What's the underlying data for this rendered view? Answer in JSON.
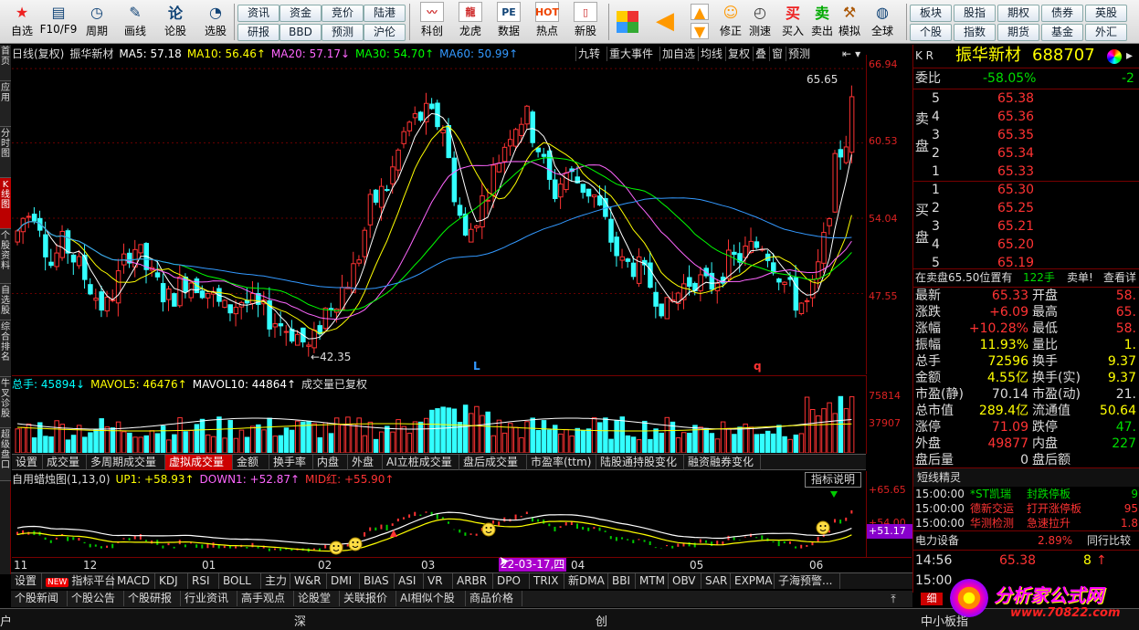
{
  "toolbar": {
    "buttons": [
      {
        "label": "自选",
        "icon": "★"
      },
      {
        "label": "F10/F9",
        "icon": "▤"
      },
      {
        "label": "周期",
        "icon": "◷"
      },
      {
        "label": "画线",
        "icon": "✎"
      },
      {
        "label": "论股",
        "icon": "论"
      },
      {
        "label": "选股",
        "icon": "◔"
      }
    ],
    "small_buttons": [
      "资讯",
      "资金",
      "竞价",
      "陆港",
      "研报",
      "BBD",
      "预测",
      "沪伦"
    ],
    "buttons2": [
      {
        "label": "科创",
        "icon": "〰"
      },
      {
        "label": "龙虎",
        "icon": "龍"
      },
      {
        "label": "数据",
        "icon": "PE"
      },
      {
        "label": "热点",
        "icon": "HOT"
      },
      {
        "label": "新股",
        "icon": "▯"
      }
    ],
    "buttons3": [
      {
        "label": "修正",
        "icon": "☺"
      },
      {
        "label": "测速",
        "icon": "◴"
      },
      {
        "label": "买入",
        "icon": "买"
      },
      {
        "label": "卖出",
        "icon": "卖"
      },
      {
        "label": "模拟",
        "icon": "⚒"
      },
      {
        "label": "全球",
        "icon": "◍"
      }
    ],
    "small_buttons2": [
      "板块",
      "股指",
      "期权",
      "债券",
      "英股",
      "个股",
      "指数",
      "期货",
      "基金",
      "外汇"
    ]
  },
  "left_tabs": [
    "首页",
    "应用",
    "分时图",
    "K线图",
    "个股资料",
    "自选股",
    "综合排名",
    "牛叉诊股",
    "超级盘口"
  ],
  "chart": {
    "header": {
      "period": "日线(复权)",
      "name": "振华新材",
      "ma5": "MA5: 57.18",
      "ma10": "MA10: 56.46↑",
      "ma20": "MA20: 57.17↓",
      "ma30": "MA30: 54.70↑",
      "ma60": "MA60: 50.99↑"
    },
    "right_buttons": [
      "九转",
      "重大事件",
      "加自选",
      "均线",
      "复权",
      "叠",
      "窗",
      "预测"
    ],
    "price_axis": [
      "66.94",
      "60.53",
      "54.04",
      "47.55"
    ],
    "high_label": "65.65",
    "low_label": "42.35",
    "marker_l": "L",
    "marker_q": "q",
    "colors": {
      "up": "#ff3333",
      "down": "#33ffff",
      "ma5": "#ffffff",
      "ma10": "#ffff00",
      "ma20": "#ff66ff",
      "ma30": "#00ff00",
      "ma60": "#3399ff"
    }
  },
  "volume": {
    "header": {
      "total": "总手: 45894↓",
      "mavol5": "MAVOL5: 46476↑",
      "mavol10": "MAVOL10: 44864↑",
      "note": "成交量已复权"
    },
    "axis": [
      "75814",
      "37907"
    ]
  },
  "vol_tabs": [
    "设置",
    "成交量",
    "多周期成交量",
    "虚拟成交量",
    "金额",
    "换手率",
    "内盘",
    "外盘",
    "AI立桩成交量",
    "盘后成交量",
    "市盈率(ttm)",
    "陆股通持股变化",
    "融资融券变化"
  ],
  "indicator": {
    "header": {
      "name": "自用蜡烛图(1,13,0)",
      "up1": "UP1: +58.93↑",
      "down1": "DOWN1: +52.87↑",
      "mid": "MID红: +55.90↑"
    },
    "explain_button": "指标说明",
    "axis": [
      "+65.65",
      "+54.00"
    ],
    "current": "+51.17"
  },
  "date_axis": {
    "labels": [
      "11",
      "12",
      "01",
      "02",
      "03",
      "04",
      "05",
      "06"
    ],
    "cursor_date": "22-03-17,四"
  },
  "bottom_tabs": [
    "设置",
    "指标平台",
    "MACD",
    "KDJ",
    "RSI",
    "BOLL",
    "主力",
    "W&R",
    "DMI",
    "BIAS",
    "ASI",
    "VR",
    "ARBR",
    "DPO",
    "TRIX",
    "新DMA",
    "BBI",
    "MTM",
    "OBV",
    "SAR",
    "EXPMA",
    "子海预警..."
  ],
  "bottom_badge": "NEW",
  "info_tabs": [
    "个股新闻",
    "个股公告",
    "个股研报",
    "行业资讯",
    "高手观点",
    "论股堂",
    "关联报价",
    "AI相似个股",
    "商品价格"
  ],
  "status_bar": [
    "户",
    "深",
    "创",
    "中小板指"
  ],
  "right_panel": {
    "market": "K R",
    "stock_name": "振华新材",
    "stock_code": "688707",
    "weibi_label": "委比",
    "weibi_value": "-58.05%",
    "weibi_extra": "-2",
    "sell_label": [
      "卖",
      "盘"
    ],
    "buy_label": [
      "买",
      "盘"
    ],
    "sell": [
      {
        "level": "5",
        "price": "65.38"
      },
      {
        "level": "4",
        "price": "65.36"
      },
      {
        "level": "3",
        "price": "65.35"
      },
      {
        "level": "2",
        "price": "65.34"
      },
      {
        "level": "1",
        "price": "65.33"
      }
    ],
    "buy": [
      {
        "level": "1",
        "price": "65.30"
      },
      {
        "level": "2",
        "price": "65.25"
      },
      {
        "level": "3",
        "price": "65.21"
      },
      {
        "level": "4",
        "price": "65.20"
      },
      {
        "level": "5",
        "price": "65.19"
      }
    ],
    "order_note": "在卖盘65.50位置有",
    "order_qty": "122手",
    "order_side": "卖单!",
    "order_link": "查看详",
    "stats": [
      {
        "l1": "最新",
        "v1": "65.33",
        "l2": "开盘",
        "v2": "58."
      },
      {
        "l1": "涨跌",
        "v1": "+6.09",
        "l2": "最高",
        "v2": "65."
      },
      {
        "l1": "涨幅",
        "v1": "+10.28%",
        "l2": "最低",
        "v2": "58."
      },
      {
        "l1": "振幅",
        "v1": "11.93%",
        "l2": "量比",
        "v2": "1."
      },
      {
        "l1": "总手",
        "v1": "72596",
        "l2": "换手",
        "v2": "9.37"
      },
      {
        "l1": "金额",
        "v1": "4.55亿",
        "l2": "换手(实)",
        "v2": "9.37"
      },
      {
        "l1": "市盈(静)",
        "v1": "70.14",
        "l2": "市盈(动)",
        "v2": "21."
      },
      {
        "l1": "总市值",
        "v1": "289.4亿",
        "l2": "流通值",
        "v2": "50.64"
      },
      {
        "l1": "涨停",
        "v1": "71.09",
        "l2": "跌停",
        "v2": "47."
      },
      {
        "l1": "外盘",
        "v1": "49877",
        "l2": "内盘",
        "v2": "227"
      },
      {
        "l1": "盘后量",
        "v1": "0",
        "l2": "盘后额",
        "v2": ""
      }
    ],
    "news_title": "短线精灵",
    "news": [
      {
        "time": "15:00:00",
        "name": "*ST凯瑞",
        "event": "封跌停板",
        "val": "9"
      },
      {
        "time": "15:00:00",
        "name": "德新交运",
        "event": "打开涨停板",
        "val": "95"
      },
      {
        "time": "15:00:00",
        "name": "华测检测",
        "event": "急速拉升",
        "val": "1.8"
      }
    ],
    "sector_name": "电力设备",
    "sector_pct": "2.89%",
    "sector_link": "同行比较",
    "tick_time": "14:56",
    "tick_price": "65.38",
    "tick_qty": "8",
    "tick_time2": "15:00",
    "tick_btn": "细",
    "watermark": "分析家公式网",
    "watermark_url": "www.70822.com"
  }
}
